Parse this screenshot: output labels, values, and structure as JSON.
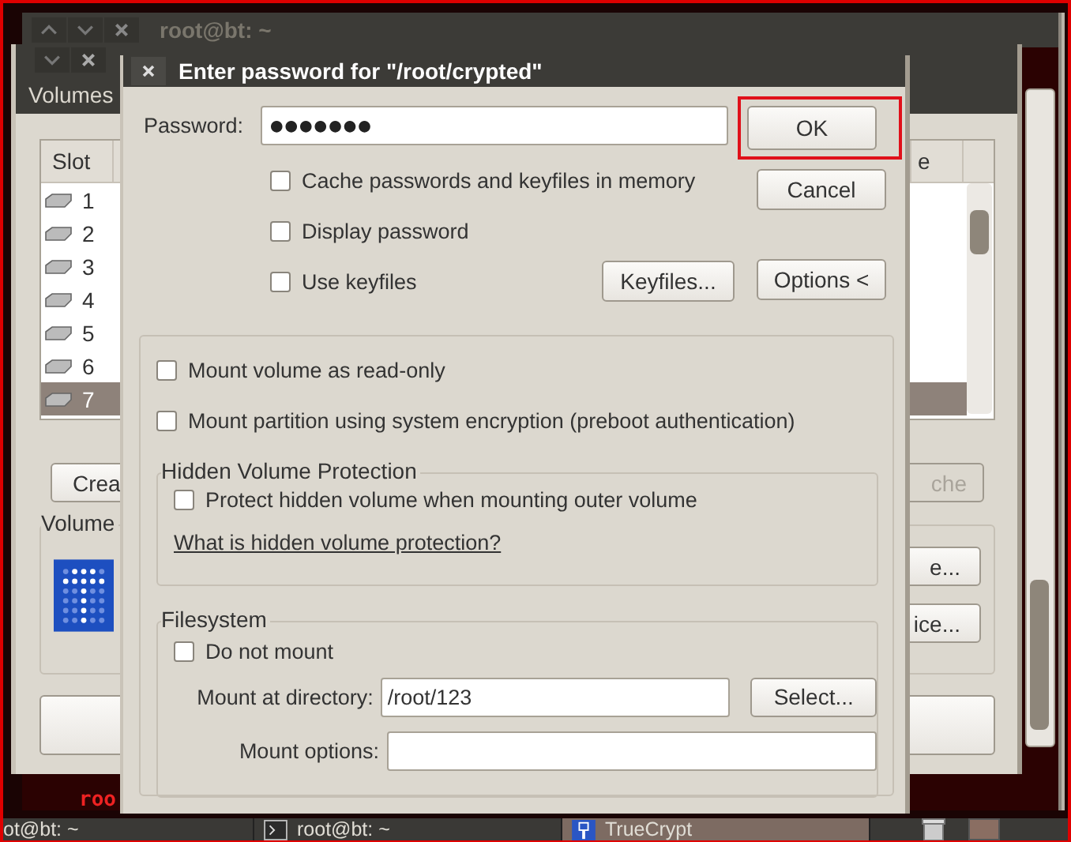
{
  "terminal_window": {
    "title": "root@bt: ~",
    "prompt": "roo"
  },
  "main_window": {
    "tab": "Volumes",
    "columns": [
      "Slot",
      "e"
    ],
    "slots": [
      {
        "label": "1",
        "selected": false
      },
      {
        "label": "2",
        "selected": false
      },
      {
        "label": "3",
        "selected": false
      },
      {
        "label": "4",
        "selected": false
      },
      {
        "label": "5",
        "selected": false
      },
      {
        "label": "6",
        "selected": false
      },
      {
        "label": "7",
        "selected": true
      }
    ],
    "action_buttons": [
      {
        "label": "Crea",
        "disabled": false
      },
      {
        "label": "che",
        "disabled": true
      }
    ],
    "group_label": "Volume",
    "side_buttons": [
      {
        "label": "e..."
      },
      {
        "label": "ice..."
      }
    ]
  },
  "dialog": {
    "title": "Enter password for \"/root/crypted\"",
    "password_label": "Password:",
    "password_value": "●●●●●●●",
    "ok": {
      "label": "OK",
      "annotated": true
    },
    "cancel": {
      "label": "Cancel"
    },
    "checkboxes": [
      {
        "label": "Cache passwords and keyfiles in memory",
        "checked": false
      },
      {
        "label": "Display password",
        "checked": false
      },
      {
        "label": "Use keyfiles",
        "checked": false
      }
    ],
    "keyfiles_button": "Keyfiles...",
    "options_button": "Options <",
    "mount_options": [
      {
        "label": "Mount volume as read-only",
        "checked": false
      },
      {
        "label": "Mount partition using system encryption (preboot authentication)",
        "checked": false
      }
    ],
    "hidden_group": {
      "title": "Hidden Volume Protection",
      "checkbox": {
        "label": "Protect hidden volume when mounting outer volume",
        "checked": false
      },
      "link": "What is hidden volume protection?"
    },
    "filesystem_group": {
      "title": "Filesystem",
      "checkbox": {
        "label": "Do not mount",
        "checked": false
      },
      "directory_label": "Mount at directory:",
      "directory_value": "/root/123",
      "select_button": "Select...",
      "options_label": "Mount options:"
    }
  },
  "taskbar": {
    "items": [
      {
        "label": "ot@bt: ~",
        "kind": "plain",
        "selected": false
      },
      {
        "label": "root@bt: ~",
        "kind": "terminal",
        "selected": false
      },
      {
        "label": "TrueCrypt",
        "kind": "app",
        "selected": true
      }
    ]
  }
}
